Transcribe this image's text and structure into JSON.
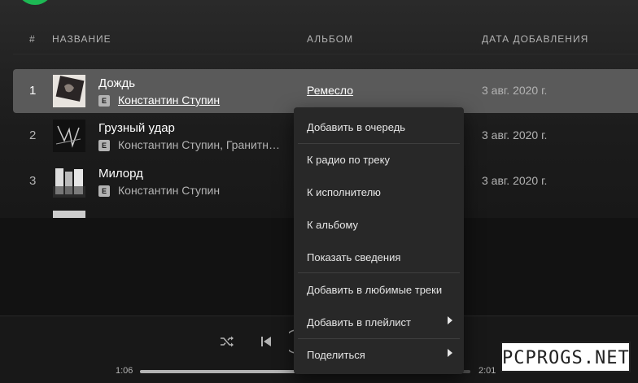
{
  "table": {
    "headers": {
      "num": "#",
      "title": "НАЗВАНИЕ",
      "album": "АЛЬБОМ",
      "date": "ДАТА ДОБАВЛЕНИЯ"
    },
    "explicit_badge": "E",
    "rows": [
      {
        "num": "1",
        "title": "Дождь",
        "artist": "Константин Ступин",
        "album": "Ремесло",
        "date": "3 авг. 2020 г."
      },
      {
        "num": "2",
        "title": "Грузный удар",
        "artist": "Константин Ступин, Гранитн…",
        "album": "",
        "date": "3 авг. 2020 г."
      },
      {
        "num": "3",
        "title": "Милорд",
        "artist": "Константин Ступин",
        "album": "",
        "date": "3 авг. 2020 г."
      }
    ]
  },
  "context_menu": {
    "items": [
      {
        "label": "Добавить в очередь",
        "submenu": false
      },
      {
        "label": "К радио по треку",
        "submenu": false
      },
      {
        "label": "К исполнителю",
        "submenu": false
      },
      {
        "label": "К альбому",
        "submenu": false
      },
      {
        "label": "Показать сведения",
        "submenu": false
      },
      {
        "label": "Добавить в любимые треки",
        "submenu": false
      },
      {
        "label": "Добавить в плейлист",
        "submenu": true
      },
      {
        "label": "Поделиться",
        "submenu": true
      }
    ]
  },
  "player": {
    "elapsed": "1:06",
    "duration": "2:01",
    "progress_fraction": 0.55,
    "icons": [
      "shuffle-icon",
      "previous-icon",
      "play-pause-icon"
    ]
  },
  "watermark": {
    "text": "PCPROGS.NET"
  },
  "colors": {
    "accent": "#1db954",
    "background": "#121212",
    "menu": "#282828",
    "active_row": "#5a5a5a"
  }
}
